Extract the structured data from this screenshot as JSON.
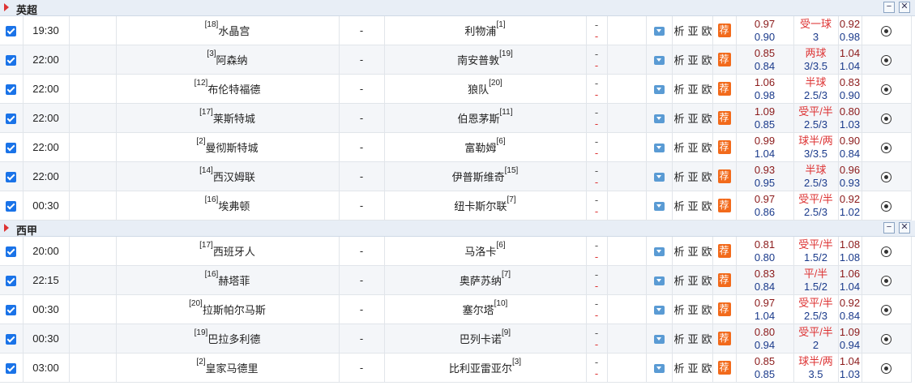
{
  "leagues": [
    {
      "name": "英超",
      "matches": [
        {
          "time": "19:30",
          "home_rank": "[18]",
          "home": "水晶宫",
          "score": "-",
          "away": "利物浦",
          "away_rank": "[1]",
          "half1": "-",
          "half2": "-",
          "odds_up": "0.97",
          "odds_dn": "0.90",
          "hcap_top": "受一球",
          "hcap_bot": "3",
          "odds2_up": "0.92",
          "odds2_dn": "0.98"
        },
        {
          "time": "22:00",
          "home_rank": "[3]",
          "home": "阿森纳",
          "score": "-",
          "away": "南安普敦",
          "away_rank": "[19]",
          "half1": "-",
          "half2": "-",
          "odds_up": "0.85",
          "odds_dn": "0.84",
          "hcap_top": "两球",
          "hcap_bot": "3/3.5",
          "odds2_up": "1.04",
          "odds2_dn": "1.04"
        },
        {
          "time": "22:00",
          "home_rank": "[12]",
          "home": "布伦特福德",
          "score": "-",
          "away": "狼队",
          "away_rank": "[20]",
          "half1": "-",
          "half2": "-",
          "odds_up": "1.06",
          "odds_dn": "0.98",
          "hcap_top": "半球",
          "hcap_bot": "2.5/3",
          "odds2_up": "0.83",
          "odds2_dn": "0.90"
        },
        {
          "time": "22:00",
          "home_rank": "[17]",
          "home": "莱斯特城",
          "score": "-",
          "away": "伯恩茅斯",
          "away_rank": "[11]",
          "half1": "-",
          "half2": "-",
          "odds_up": "1.09",
          "odds_dn": "0.85",
          "hcap_top": "受平/半",
          "hcap_bot": "2.5/3",
          "odds2_up": "0.80",
          "odds2_dn": "1.03"
        },
        {
          "time": "22:00",
          "home_rank": "[2]",
          "home": "曼彻斯特城",
          "score": "-",
          "away": "富勒姆",
          "away_rank": "[6]",
          "half1": "-",
          "half2": "-",
          "odds_up": "0.99",
          "odds_dn": "1.04",
          "hcap_top": "球半/两",
          "hcap_bot": "3/3.5",
          "odds2_up": "0.90",
          "odds2_dn": "0.84"
        },
        {
          "time": "22:00",
          "home_rank": "[14]",
          "home": "西汉姆联",
          "score": "-",
          "away": "伊普斯维奇",
          "away_rank": "[15]",
          "half1": "-",
          "half2": "-",
          "odds_up": "0.93",
          "odds_dn": "0.95",
          "hcap_top": "半球",
          "hcap_bot": "2.5/3",
          "odds2_up": "0.96",
          "odds2_dn": "0.93"
        },
        {
          "time": "00:30",
          "home_rank": "[16]",
          "home": "埃弗顿",
          "score": "-",
          "away": "纽卡斯尔联",
          "away_rank": "[7]",
          "half1": "-",
          "half2": "-",
          "odds_up": "0.97",
          "odds_dn": "0.86",
          "hcap_top": "受平/半",
          "hcap_bot": "2.5/3",
          "odds2_up": "0.92",
          "odds2_dn": "1.02"
        }
      ]
    },
    {
      "name": "西甲",
      "matches": [
        {
          "time": "20:00",
          "home_rank": "[17]",
          "home": "西班牙人",
          "score": "-",
          "away": "马洛卡",
          "away_rank": "[6]",
          "half1": "-",
          "half2": "-",
          "odds_up": "0.81",
          "odds_dn": "0.80",
          "hcap_top": "受平/半",
          "hcap_bot": "1.5/2",
          "odds2_up": "1.08",
          "odds2_dn": "1.08"
        },
        {
          "time": "22:15",
          "home_rank": "[16]",
          "home": "赫塔菲",
          "score": "-",
          "away": "奥萨苏纳",
          "away_rank": "[7]",
          "half1": "-",
          "half2": "-",
          "odds_up": "0.83",
          "odds_dn": "0.84",
          "hcap_top": "平/半",
          "hcap_bot": "1.5/2",
          "odds2_up": "1.06",
          "odds2_dn": "1.04"
        },
        {
          "time": "00:30",
          "home_rank": "[20]",
          "home": "拉斯帕尔马斯",
          "score": "-",
          "away": "塞尔塔",
          "away_rank": "[10]",
          "half1": "-",
          "half2": "-",
          "odds_up": "0.97",
          "odds_dn": "1.04",
          "hcap_top": "受平/半",
          "hcap_bot": "2.5/3",
          "odds2_up": "0.92",
          "odds2_dn": "0.84"
        },
        {
          "time": "00:30",
          "home_rank": "[19]",
          "home": "巴拉多利德",
          "score": "-",
          "away": "巴列卡诺",
          "away_rank": "[9]",
          "half1": "-",
          "half2": "-",
          "odds_up": "0.80",
          "odds_dn": "0.94",
          "hcap_top": "受平/半",
          "hcap_bot": "2",
          "odds2_up": "1.09",
          "odds2_dn": "0.94"
        },
        {
          "time": "03:00",
          "home_rank": "[2]",
          "home": "皇家马德里",
          "score": "-",
          "away": "比利亚雷亚尔",
          "away_rank": "[3]",
          "half1": "-",
          "half2": "-",
          "odds_up": "0.85",
          "odds_dn": "0.85",
          "hcap_top": "球半/两",
          "hcap_bot": "3.5",
          "odds2_up": "1.04",
          "odds2_dn": "1.03"
        }
      ]
    }
  ],
  "links": {
    "analysis": "析",
    "asia": "亚",
    "europe": "欧",
    "recommend": "荐"
  },
  "icons": {
    "league_arrow": "arrow-right-icon",
    "collapse": "minus-icon",
    "close": "close-icon",
    "dropdown": "dropdown-icon",
    "ball": "football-icon",
    "checkbox": "checkbox-checked-icon"
  },
  "controls": {
    "collapse_symbol": "−",
    "close_symbol": "✕"
  },
  "colors": {
    "checkbox": "#1a73e8",
    "recommend": "#f26a1b",
    "odds_up": "#8b1a1a",
    "odds_dn": "#1a3a8b",
    "hcap": "#d33"
  }
}
